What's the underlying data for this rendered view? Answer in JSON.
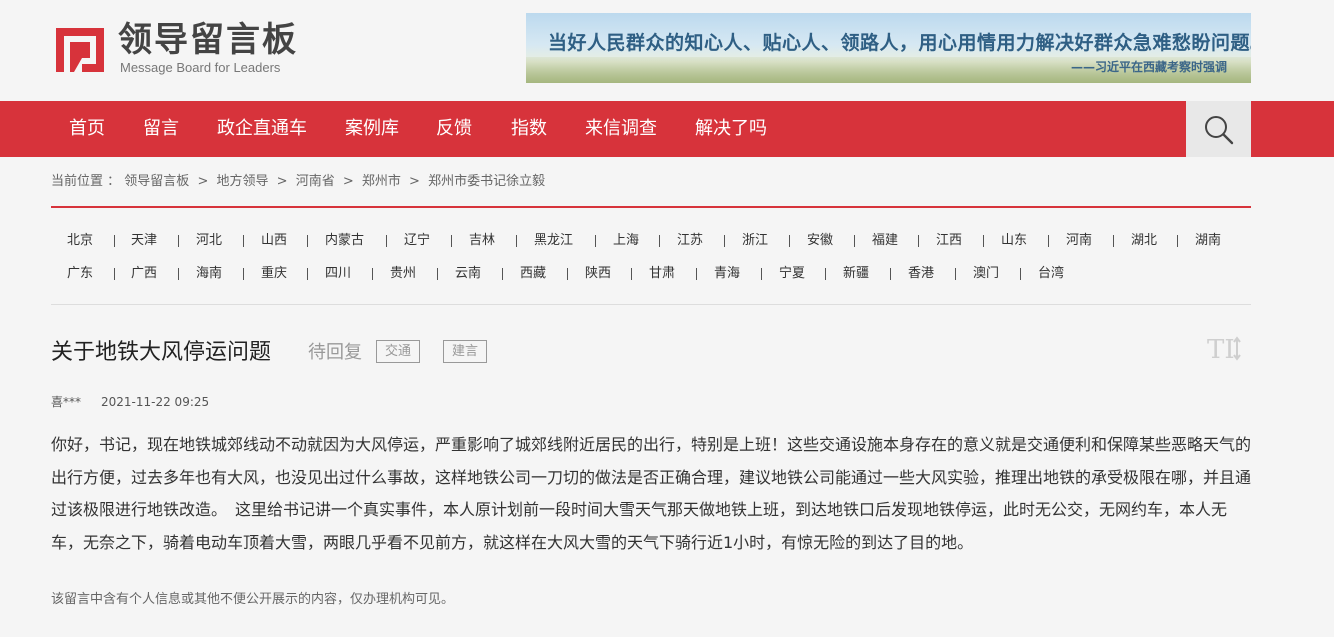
{
  "header": {
    "logo_cn": "领导留言板",
    "logo_en": "Message Board for Leaders",
    "banner_quote": "当好人民群众的知心人、贴心人、领路人，用心用情用力解决好群众急难愁盼问题。",
    "banner_source": "——习近平在西藏考察时强调"
  },
  "nav": {
    "items": [
      "首页",
      "留言",
      "政企直通车",
      "案例库",
      "反馈",
      "指数",
      "来信调查",
      "解决了吗"
    ],
    "search_icon": "search-icon"
  },
  "breadcrumb": {
    "label": "当前位置 ：",
    "items": [
      "领导留言板",
      "地方领导",
      "河南省",
      "郑州市",
      "郑州市委书记徐立毅"
    ],
    "separator": ">"
  },
  "provinces": {
    "row1": [
      "北京",
      "天津",
      "河北",
      "山西",
      "内蒙古",
      "辽宁",
      "吉林",
      "黑龙江",
      "上海",
      "江苏",
      "浙江",
      "安徽",
      "福建",
      "江西",
      "山东",
      "河南",
      "湖北",
      "湖南"
    ],
    "row2": [
      "广东",
      "广西",
      "海南",
      "重庆",
      "四川",
      "贵州",
      "云南",
      "西藏",
      "陕西",
      "甘肃",
      "青海",
      "宁夏",
      "新疆",
      "香港",
      "澳门",
      "台湾"
    ]
  },
  "message": {
    "title": "关于地铁大风停运问题",
    "status": "待回复",
    "tags": [
      "交通",
      "建言"
    ],
    "font_toggle_label": "TI",
    "author": "喜***",
    "date": "2021-11-22 09:25",
    "content": "你好，书记，现在地铁城郊线动不动就因为大风停运，严重影响了城郊线附近居民的出行，特别是上班！这些交通设施本身存在的意义就是交通便利和保障某些恶略天气的出行方便，过去多年也有大风，也没见出过什么事故，这样地铁公司一刀切的做法是否正确合理，建议地铁公司能通过一些大风实验，推理出地铁的承受极限在哪，并且通过该极限进行地铁改造。　这里给书记讲一个真实事件，本人原计划前一段时间大雪天气那天做地铁上班，到达地铁口后发现地铁停运，此时无公交，无网约车，本人无车，无奈之下，骑着电动车顶着大雪，两眼几乎看不见前方，就这样在大风大雪的天气下骑行近1小时，有惊无险的到达了目的地。",
    "notice": "该留言中含有个人信息或其他不便公开展示的内容，仅办理机构可见。"
  },
  "colors": {
    "brand_red": "#d7333b",
    "background": "#f5f5f5"
  }
}
